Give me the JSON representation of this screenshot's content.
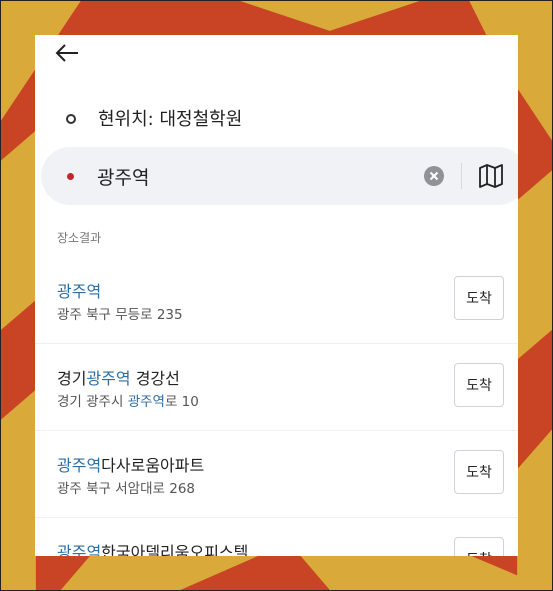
{
  "origin": {
    "text": "현위치: 대정철학원"
  },
  "destination": {
    "value": "광주역"
  },
  "section_label": "장소결과",
  "results": [
    {
      "title_pre": "",
      "title_hl": "광주역",
      "title_post": "",
      "addr_pre": "광주 북구 무등로 235",
      "addr_hl": "",
      "addr_post": "",
      "button": "도착"
    },
    {
      "title_pre": "경기",
      "title_hl": "광주역",
      "title_post": " 경강선",
      "addr_pre": "경기 광주시 ",
      "addr_hl": "광주역",
      "addr_post": "로 10",
      "button": "도착"
    },
    {
      "title_pre": "",
      "title_hl": "광주역",
      "title_post": "다사로움아파트",
      "addr_pre": "광주 북구 서암대로 268",
      "addr_hl": "",
      "addr_post": "",
      "button": "도착"
    },
    {
      "title_pre": "",
      "title_hl": "광주역",
      "title_post": "한국아델리움오피스텔",
      "addr_pre": "",
      "addr_hl": "",
      "addr_post": "",
      "button": "도착"
    }
  ],
  "icons": {
    "back": "arrow-left-icon",
    "clear": "clear-circle-icon",
    "map": "folded-map-icon"
  },
  "colors": {
    "highlight": "#2f6ea3",
    "destination_dot": "#c0272d",
    "background_red": "#c94424",
    "background_yellow": "#d9a93a"
  }
}
